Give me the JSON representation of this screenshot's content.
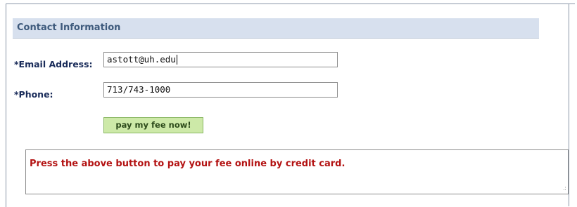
{
  "section": {
    "title": "Contact Information"
  },
  "fields": {
    "email": {
      "label": "*Email Address:",
      "value": "astott@uh.edu"
    },
    "phone": {
      "label": "*Phone:",
      "value": "713/743-1000"
    }
  },
  "pay_button": {
    "label": "pay my fee now!"
  },
  "message": {
    "text": "Press the above button to pay your fee online by credit card."
  },
  "colors": {
    "header_bg": "#d7e0ee",
    "label_text": "#1a2c5a",
    "button_bg": "#cde9a8",
    "message_text": "#b31212"
  },
  "icons": {
    "resize_grip": "resize-grip-icon"
  }
}
